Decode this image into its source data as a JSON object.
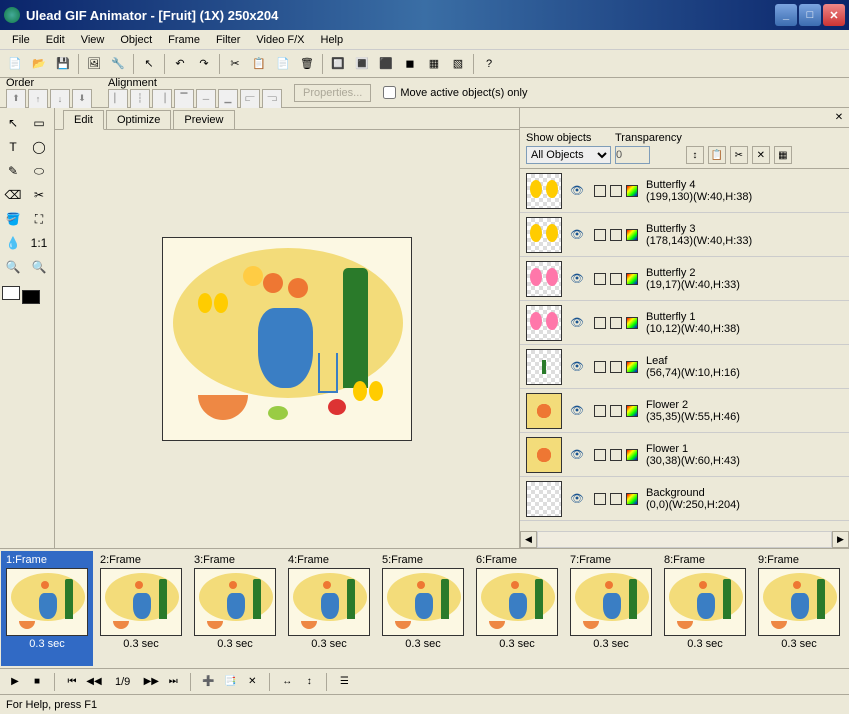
{
  "titlebar": {
    "title": "Ulead GIF Animator - [Fruit] (1X) 250x204"
  },
  "menubar": [
    "File",
    "Edit",
    "View",
    "Object",
    "Frame",
    "Filter",
    "Video F/X",
    "Help"
  ],
  "orderbar": {
    "order_label": "Order",
    "alignment_label": "Alignment",
    "properties_btn": "Properties...",
    "move_active": "Move active object(s) only"
  },
  "edittabs": [
    "Edit",
    "Optimize",
    "Preview"
  ],
  "layers": {
    "panel_header_show": "Show objects",
    "panel_header_trans": "Transparency",
    "dropdown": "All Objects",
    "trans_value": "0",
    "items": [
      {
        "name": "Butterfly 4",
        "coords": "(199,130)(W:40,H:38)",
        "thumb": "bf_yellow"
      },
      {
        "name": "Butterfly 3",
        "coords": "(178,143)(W:40,H:33)",
        "thumb": "bf_yellow"
      },
      {
        "name": "Butterfly 2",
        "coords": "(19,17)(W:40,H:33)",
        "thumb": "bf_pink"
      },
      {
        "name": "Butterfly 1",
        "coords": "(10,12)(W:40,H:38)",
        "thumb": "bf_pink"
      },
      {
        "name": "Leaf",
        "coords": "(56,74)(W:10,H:16)",
        "thumb": "leaf"
      },
      {
        "name": "Flower 2",
        "coords": "(35,35)(W:55,H:46)",
        "thumb": "flower"
      },
      {
        "name": "Flower 1",
        "coords": "(30,38)(W:60,H:43)",
        "thumb": "flower"
      },
      {
        "name": "Background",
        "coords": "(0,0)(W:250,H:204)",
        "thumb": "bg"
      }
    ]
  },
  "frames": [
    {
      "label": "1:Frame",
      "time": "0.3 sec",
      "selected": true
    },
    {
      "label": "2:Frame",
      "time": "0.3 sec",
      "selected": false
    },
    {
      "label": "3:Frame",
      "time": "0.3 sec",
      "selected": false
    },
    {
      "label": "4:Frame",
      "time": "0.3 sec",
      "selected": false
    },
    {
      "label": "5:Frame",
      "time": "0.3 sec",
      "selected": false
    },
    {
      "label": "6:Frame",
      "time": "0.3 sec",
      "selected": false
    },
    {
      "label": "7:Frame",
      "time": "0.3 sec",
      "selected": false
    },
    {
      "label": "8:Frame",
      "time": "0.3 sec",
      "selected": false
    },
    {
      "label": "9:Frame",
      "time": "0.3 sec",
      "selected": false
    }
  ],
  "playbar": {
    "counter": "1/9"
  },
  "statusbar": {
    "text": "For Help, press F1"
  }
}
